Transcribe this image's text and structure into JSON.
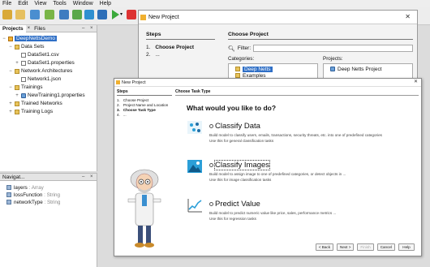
{
  "menubar": [
    "File",
    "Edit",
    "View",
    "Tools",
    "Window",
    "Help"
  ],
  "project_panel": {
    "tabs": [
      "Projects",
      "Files"
    ],
    "tree": [
      {
        "label": "DeepNettsDemo",
        "icon": "project-icon",
        "depth": 0,
        "toggle": "−",
        "selected": true
      },
      {
        "label": "Data Sets",
        "icon": "folder-icon",
        "depth": 1,
        "toggle": "−"
      },
      {
        "label": "DataSet1.csv",
        "icon": "file-icon",
        "depth": 2,
        "toggle": ""
      },
      {
        "label": "DataSet1.properties",
        "icon": "file-icon",
        "depth": 2,
        "toggle": "+"
      },
      {
        "label": "Network Architectures",
        "icon": "folder-icon",
        "depth": 1,
        "toggle": "−"
      },
      {
        "label": "Network1.json",
        "icon": "file-icon",
        "depth": 2,
        "toggle": ""
      },
      {
        "label": "Trainings",
        "icon": "folder-icon",
        "depth": 1,
        "toggle": "−"
      },
      {
        "label": "NewTraining1.properties",
        "icon": "network-icon",
        "depth": 2,
        "toggle": "+"
      },
      {
        "label": "Trained Networks",
        "icon": "folder-icon",
        "depth": 1,
        "toggle": "+"
      },
      {
        "label": "Training Logs",
        "icon": "folder-icon",
        "depth": 1,
        "toggle": "+"
      }
    ]
  },
  "navigator": {
    "title": "Navigat...",
    "rows": [
      {
        "name": "layers",
        "type": " : Array"
      },
      {
        "name": "lossFunction",
        "type": " : String"
      },
      {
        "name": "networkType",
        "type": " : String"
      }
    ]
  },
  "back_dialog": {
    "title": "New Project",
    "steps_header": "Steps",
    "steps": [
      {
        "num": "1.",
        "label": "Choose Project"
      },
      {
        "num": "2.",
        "label": "..."
      }
    ],
    "main_header": "Choose Project",
    "filter_label": "Filter:",
    "categories_label": "Categories:",
    "categories": [
      {
        "label": "Deep Netts",
        "selected": true
      },
      {
        "label": "Examples",
        "selected": false
      }
    ],
    "projects_label": "Projects:",
    "projects": [
      {
        "label": "Deep Netts Project",
        "selected": false
      }
    ]
  },
  "front_dialog": {
    "title": "New Project",
    "steps_header": "Steps",
    "steps": [
      {
        "num": "1.",
        "label": "Choose Project"
      },
      {
        "num": "2.",
        "label": "Project Name and Location"
      },
      {
        "num": "3.",
        "label": "Choose Task Type"
      },
      {
        "num": "4.",
        "label": "..."
      }
    ],
    "current_step": 2,
    "main_header": "Choose Task Type",
    "question": "What would you like to do?",
    "options": [
      {
        "label": "Classify Data",
        "icon": "scatter-plot-icon",
        "desc1": "Build model to classify users, emails, transactions, security threats, etc. into one of predefined categories",
        "desc2": "Use this for general classification tasks",
        "focused": false
      },
      {
        "label": "Classify Images",
        "icon": "image-icon",
        "desc1": "Build model to assign image to one of predefined categories, or detect objects in ...",
        "desc2": "Use this for image classification tasks",
        "focused": true
      },
      {
        "label": "Predict Value",
        "icon": "line-chart-icon",
        "desc1": "Build model to predict numeric value like price, sales, performance metrics ...",
        "desc2": "Use this for regression tasks",
        "focused": false
      }
    ],
    "buttons": {
      "back": "< Back",
      "next": "Next >",
      "finish": "Finish",
      "cancel": "Cancel",
      "help": "Help"
    }
  },
  "colors": {
    "selection": "#2f6fc6",
    "folder": "#e8c35a",
    "accent_blue": "#2b9fd8"
  }
}
